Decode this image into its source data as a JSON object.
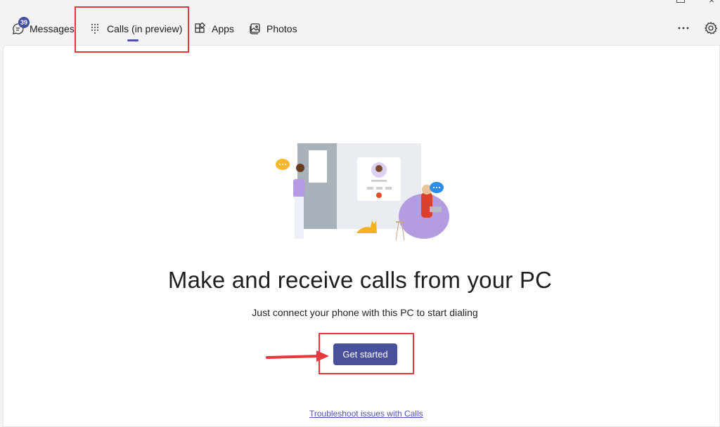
{
  "nav": {
    "tabs": [
      {
        "label": "Messages",
        "icon": "chat-icon",
        "badge": "39"
      },
      {
        "label": "Calls (in preview)",
        "icon": "dialpad-icon",
        "active": true
      },
      {
        "label": "Apps",
        "icon": "apps-icon"
      },
      {
        "label": "Photos",
        "icon": "photos-icon"
      }
    ],
    "more_icon": "more-icon",
    "settings_icon": "gear-icon"
  },
  "main": {
    "title": "Make and receive calls from your PC",
    "subtitle": "Just connect your phone with this PC to start dialing",
    "primary_button": "Get started",
    "link": "Troubleshoot issues with Calls"
  },
  "colors": {
    "accent": "#4f52b2",
    "button": "#4a519c",
    "annotation": "#e5393f"
  }
}
